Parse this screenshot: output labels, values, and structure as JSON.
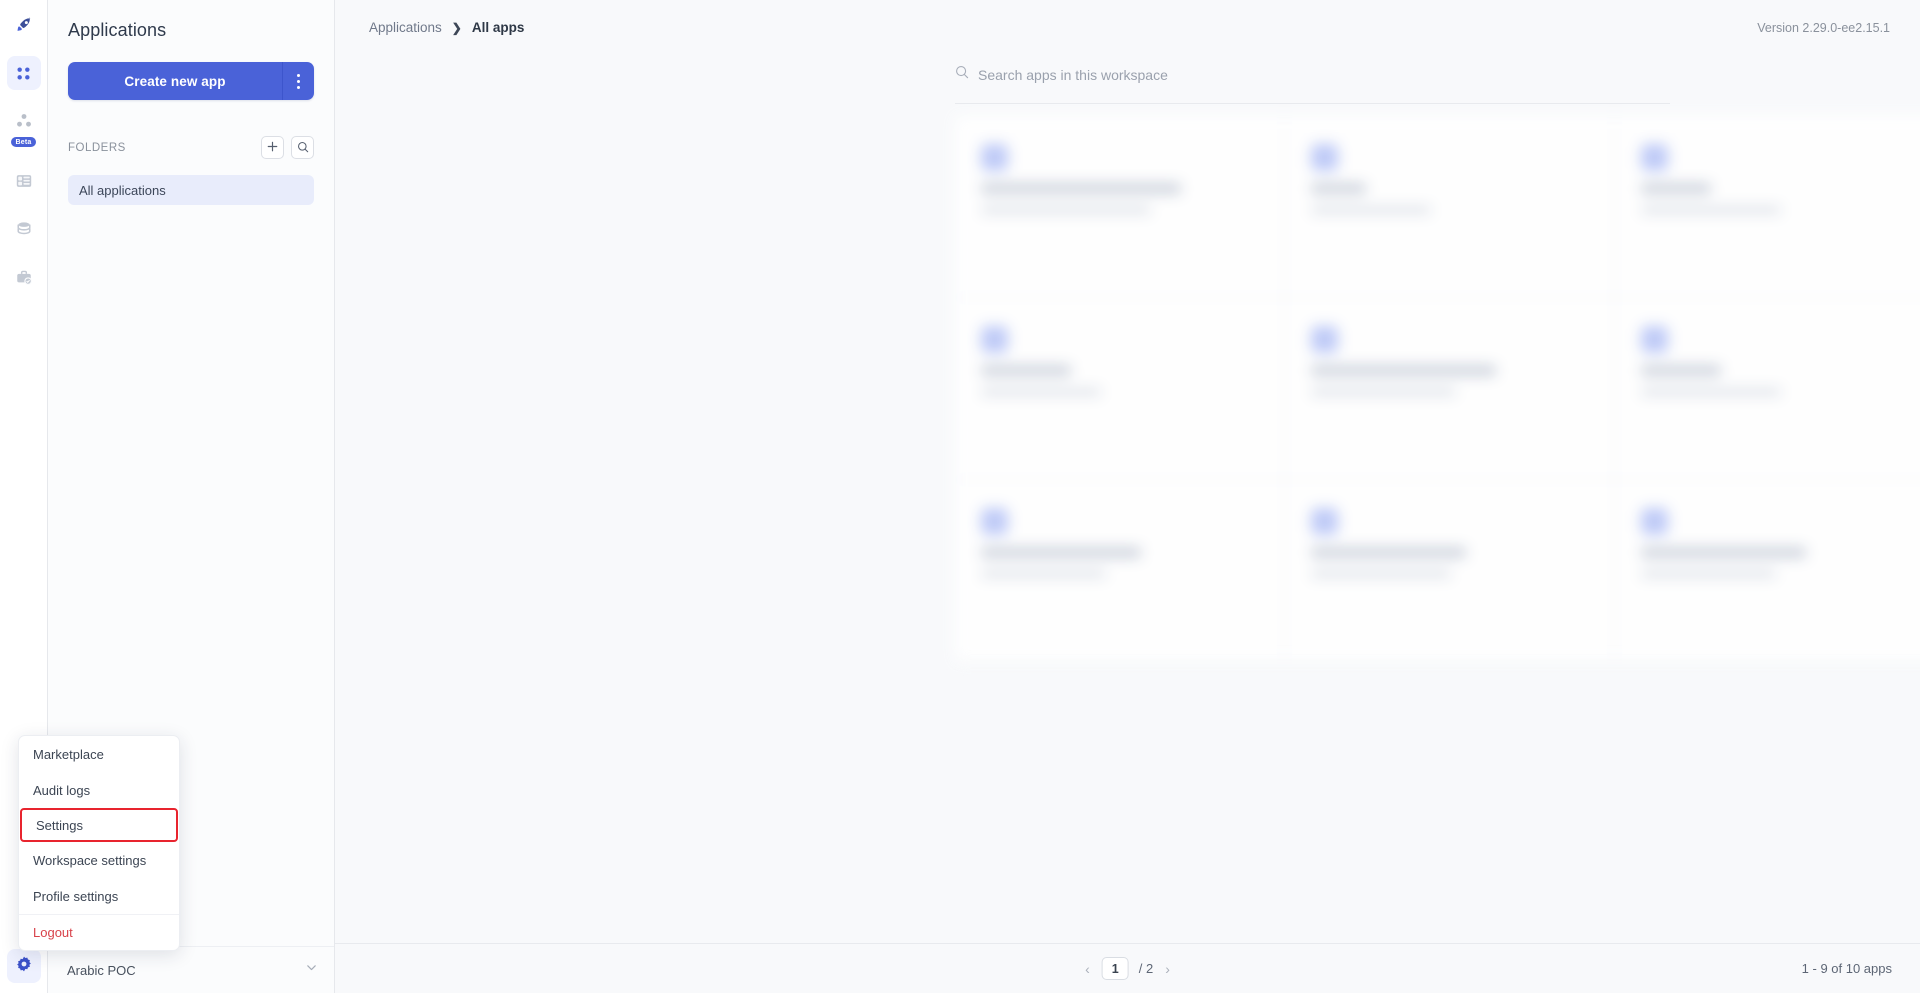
{
  "rail": {
    "items": [
      {
        "name": "rocket-icon",
        "label": "Launch",
        "active": false
      },
      {
        "name": "apps-grid-icon",
        "label": "Applications",
        "active": true
      },
      {
        "name": "workflows-icon",
        "label": "Workflows",
        "active": false,
        "badge": "Beta"
      },
      {
        "name": "tables-icon",
        "label": "Tables",
        "active": false
      },
      {
        "name": "database-icon",
        "label": "Data sources",
        "active": false
      },
      {
        "name": "workspace-constants-icon",
        "label": "Workspace constants",
        "active": false
      }
    ],
    "settings_label": "Settings"
  },
  "sidebar": {
    "title": "Applications",
    "create_button": "Create new app",
    "create_kebab_label": "More create options",
    "folders_label": "FOLDERS",
    "add_folder_label": "+",
    "search_folder_label": "Search folders",
    "folders": [
      {
        "label": "All applications",
        "selected": true
      }
    ],
    "workspace": {
      "name": "Arabic POC"
    }
  },
  "header": {
    "breadcrumb_root": "Applications",
    "breadcrumb_separator": "❯",
    "breadcrumb_current": "All apps",
    "version": "Version 2.29.0-ee2.15.1"
  },
  "search": {
    "placeholder": "Search apps in this workspace",
    "value": "",
    "icon": "search-icon"
  },
  "apps_grid": {
    "blurred": true,
    "rows": 3,
    "columns": 3,
    "cards": [
      {
        "title_width": 200,
        "sub_width": 170
      },
      {
        "title_width": 55,
        "sub_width": 120
      },
      {
        "title_width": 70,
        "sub_width": 140
      },
      {
        "title_width": 90,
        "sub_width": 120
      },
      {
        "title_width": 185,
        "sub_width": 145
      },
      {
        "title_width": 80,
        "sub_width": 140
      },
      {
        "title_width": 160,
        "sub_width": 125
      },
      {
        "title_width": 155,
        "sub_width": 140
      },
      {
        "title_width": 165,
        "sub_width": 135
      }
    ]
  },
  "footer": {
    "prev_label": "‹",
    "page_current": "1",
    "page_total": "/ 2",
    "next_label": "›",
    "apps_count": "1 - 9 of 10 apps"
  },
  "context_menu": {
    "items": [
      {
        "label": "Marketplace",
        "highlighted": false,
        "danger": false,
        "separator_top": false
      },
      {
        "label": "Audit logs",
        "highlighted": false,
        "danger": false,
        "separator_top": false
      },
      {
        "label": "Settings",
        "highlighted": true,
        "danger": false,
        "separator_top": true
      },
      {
        "label": "Workspace settings",
        "highlighted": false,
        "danger": false,
        "separator_top": false
      },
      {
        "label": "Profile settings",
        "highlighted": false,
        "danger": false,
        "separator_top": false
      },
      {
        "label": "Logout",
        "highlighted": false,
        "danger": true,
        "separator_top": true
      }
    ]
  },
  "colors": {
    "accent": "#4a62d8",
    "accent_soft": "#e8ecfb",
    "danger": "#d8424a",
    "highlight_outline": "#e8242e",
    "canvas": "#f8f9fb"
  }
}
